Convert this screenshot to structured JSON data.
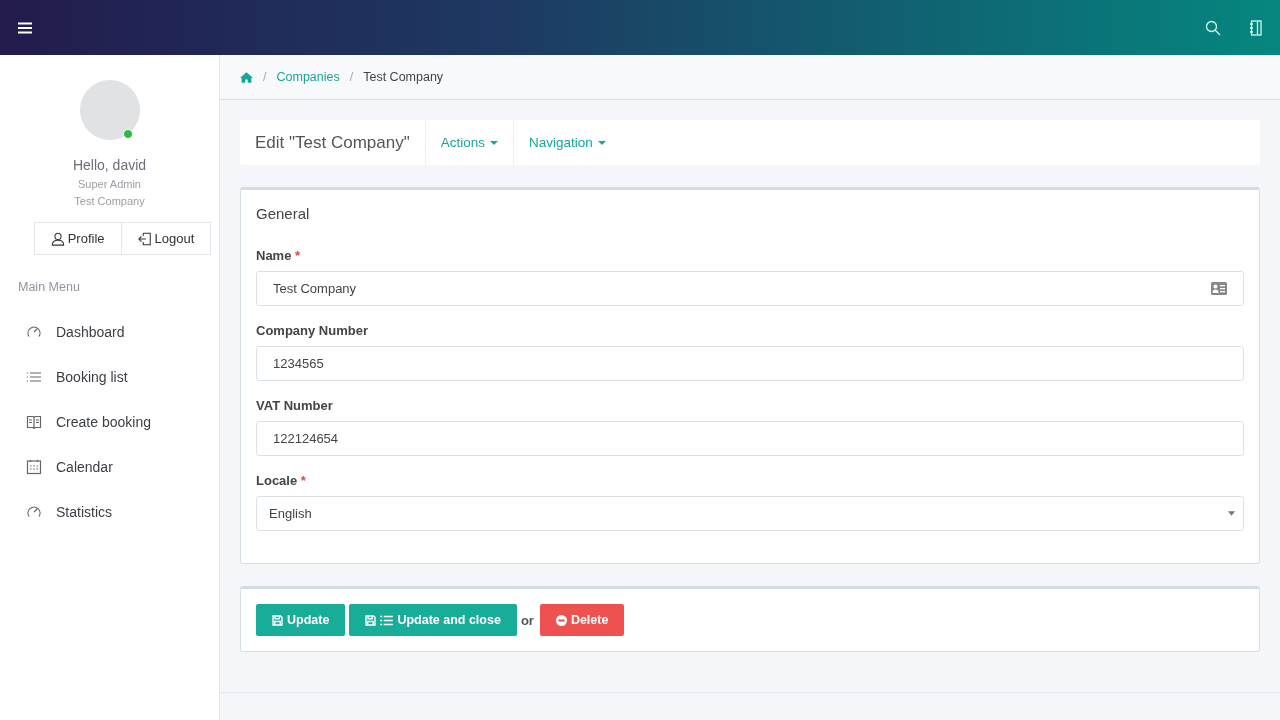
{
  "user": {
    "greeting": "Hello, david",
    "role": "Super Admin",
    "company": "Test Company",
    "online": true
  },
  "user_buttons": [
    {
      "label": "Profile",
      "kind": "profile"
    },
    {
      "label": "Logout",
      "kind": "logout"
    }
  ],
  "menu": {
    "title": "Main Menu",
    "items": [
      {
        "label": "Dashboard",
        "kind": "gauge"
      },
      {
        "label": "Booking list",
        "kind": "list"
      },
      {
        "label": "Create booking",
        "kind": "book"
      },
      {
        "label": "Calendar",
        "kind": "calendar"
      },
      {
        "label": "Statistics",
        "kind": "gauge"
      }
    ]
  },
  "breadcrumb": [
    {
      "separator": "/",
      "label": "Companies",
      "kind": "link"
    },
    {
      "separator": "/",
      "label": "Test Company",
      "kind": "current"
    }
  ],
  "page_header": {
    "title": "Edit \"Test Company\"",
    "dropdowns": [
      "Actions",
      "Navigation"
    ]
  },
  "form": {
    "title": "General",
    "fields": [
      {
        "label": "Name",
        "required_mark": "*",
        "value": "Test Company",
        "kind": "card-text"
      },
      {
        "label": "Company Number",
        "value": "1234565",
        "kind": "text"
      },
      {
        "label": "VAT Number",
        "value": "122124654",
        "kind": "text"
      },
      {
        "label": "Locale",
        "required_mark": "*",
        "value": "English",
        "kind": "select"
      }
    ]
  },
  "actions": {
    "buttons": [
      {
        "label": "Update",
        "kind": "update"
      },
      {
        "label": "Update and close",
        "kind": "update-close"
      }
    ],
    "separator": "or",
    "delete": {
      "label": "Delete",
      "kind": "delete"
    }
  }
}
